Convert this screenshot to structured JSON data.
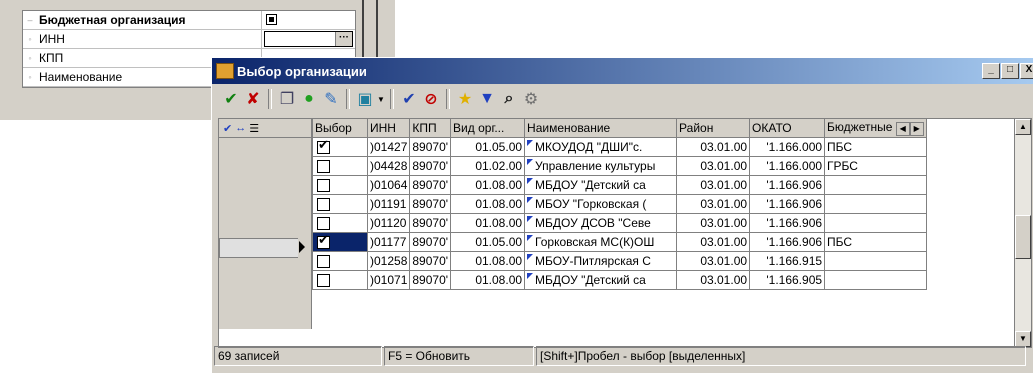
{
  "background_panel": {
    "rows": [
      {
        "label": "Бюджетная организация",
        "type": "group",
        "prefix": "–"
      },
      {
        "label": "ИНН",
        "type": "field",
        "dots": "···"
      },
      {
        "label": "КПП",
        "type": "field"
      },
      {
        "label": "Наименование",
        "type": "field"
      }
    ]
  },
  "dialog": {
    "title": "Выбор организации",
    "window_buttons": {
      "minimize": "_",
      "maximize": "□",
      "close": "X"
    },
    "toolbar": {
      "icons": [
        "check-icon",
        "cancel-icon",
        "copy-icon",
        "add-icon",
        "edit-icon",
        "export-icon",
        "apply-icon",
        "clear-selection-icon",
        "favorite-icon",
        "filter-icon",
        "find-icon",
        "settings-icon"
      ]
    },
    "grid": {
      "columns": [
        "Выбор",
        "ИНН",
        "КПП",
        "Вид орг...",
        "Наименование",
        "Район",
        "ОКАТО",
        "Бюджетные"
      ],
      "rows": [
        {
          "checked": true,
          "inn": ")01427",
          "kpp": "89070'",
          "vid": "01.05.00",
          "name": "МКОУДОД \"ДШИ\"с.",
          "rayon": "03.01.00",
          "okato": "'1.166.000",
          "budget": "ПБС",
          "current": false
        },
        {
          "checked": false,
          "inn": ")04428",
          "kpp": "89070'",
          "vid": "01.02.00",
          "name": "Управление культуры",
          "rayon": "03.01.00",
          "okato": "'1.166.000",
          "budget": "ГРБС",
          "current": false
        },
        {
          "checked": false,
          "inn": ")01064",
          "kpp": "89070'",
          "vid": "01.08.00",
          "name": "МБДОУ \"Детский са",
          "rayon": "03.01.00",
          "okato": "'1.166.906",
          "budget": "",
          "current": false
        },
        {
          "checked": false,
          "inn": ")01191",
          "kpp": "89070'",
          "vid": "01.08.00",
          "name": "МБОУ \"Горковская (",
          "rayon": "03.01.00",
          "okato": "'1.166.906",
          "budget": "",
          "current": false
        },
        {
          "checked": false,
          "inn": ")01120",
          "kpp": "89070'",
          "vid": "01.08.00",
          "name": "МБДОУ ДСОВ \"Севе",
          "rayon": "03.01.00",
          "okato": "'1.166.906",
          "budget": "",
          "current": false
        },
        {
          "checked": true,
          "inn": ")01177",
          "kpp": "89070'",
          "vid": "01.05.00",
          "name": "Горковская МС(К)ОШ",
          "rayon": "03.01.00",
          "okato": "'1.166.906",
          "budget": "ПБС",
          "current": true
        },
        {
          "checked": false,
          "inn": ")01258",
          "kpp": "89070'",
          "vid": "01.08.00",
          "name": "МБОУ-Питлярская С",
          "rayon": "03.01.00",
          "okato": "'1.166.915",
          "budget": "",
          "current": false
        },
        {
          "checked": false,
          "inn": ")01071",
          "kpp": "89070'",
          "vid": "01.08.00",
          "name": "МБДОУ \"Детский са",
          "rayon": "03.01.00",
          "okato": "'1.166.905",
          "budget": "",
          "current": false
        }
      ]
    },
    "status": {
      "count": "69 записей",
      "refresh": "F5 = Обновить",
      "hint": "[Shift+]Пробел - выбор [выделенных]"
    }
  }
}
